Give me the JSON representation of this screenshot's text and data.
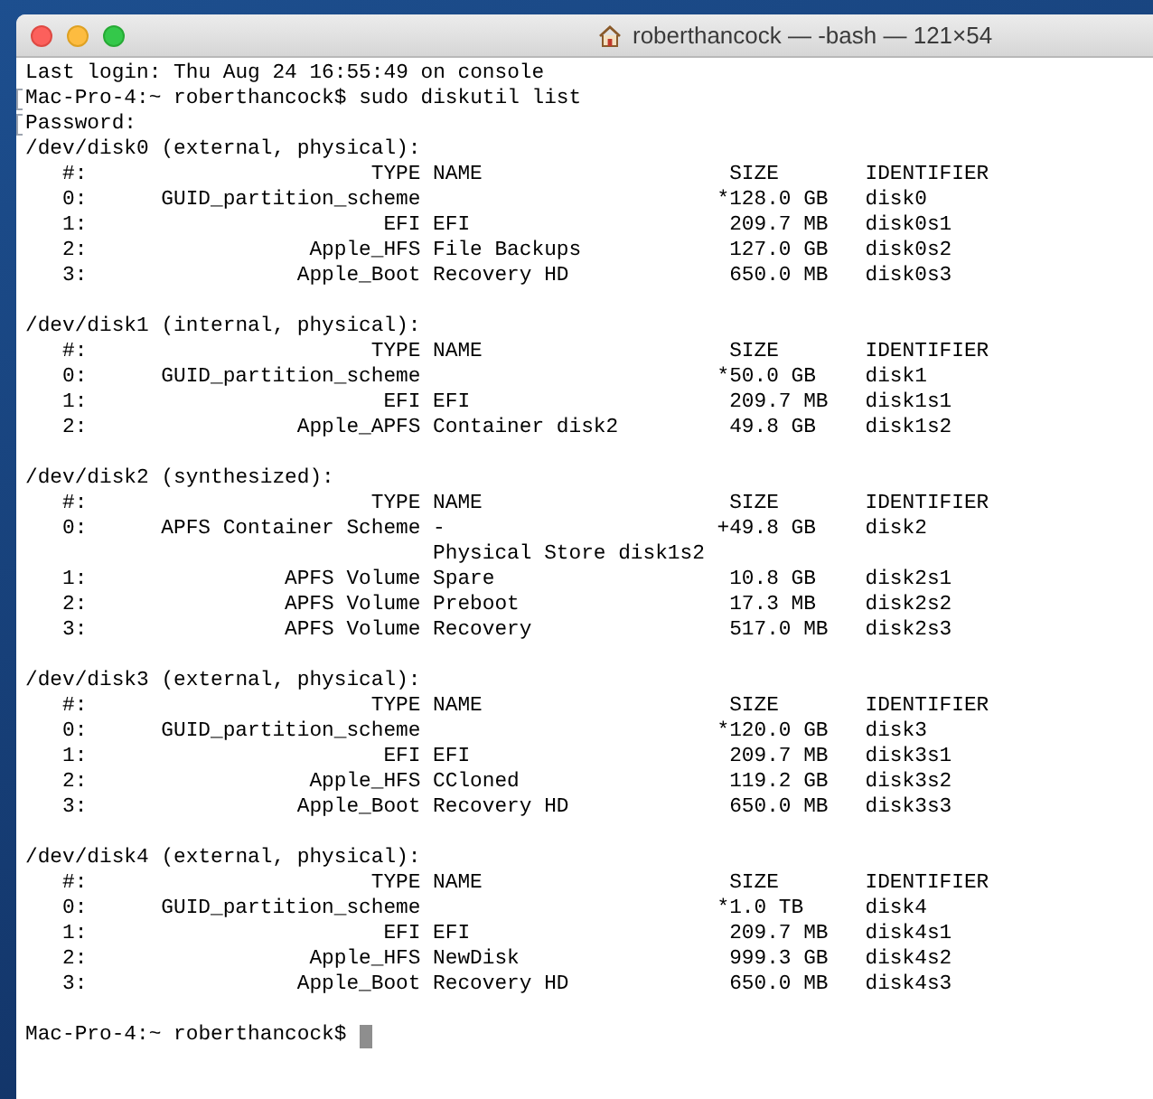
{
  "window": {
    "title": "roberthancock — -bash — 121×54"
  },
  "terminal": {
    "login": "Last login: Thu Aug 24 16:55:49 on console",
    "command": {
      "prompt": "Mac-Pro-4:~ roberthancock$",
      "text": "sudo diskutil list",
      "marked": true
    },
    "password": {
      "text": "Password:",
      "marked": true
    },
    "disks": [
      {
        "header": "/dev/disk0 (external, physical):",
        "columns": {
          "number": "#:",
          "type": "TYPE",
          "name": "NAME",
          "size": "SIZE",
          "identifier": "IDENTIFIER"
        },
        "rows": [
          {
            "number": "0:",
            "type": "GUID_partition_scheme",
            "flag": "*",
            "size": "128.0 GB",
            "identifier": "disk0"
          },
          {
            "number": "1:",
            "type": "EFI",
            "name": "EFI",
            "size": "209.7 MB",
            "identifier": "disk0s1"
          },
          {
            "number": "2:",
            "type": "Apple_HFS",
            "name": "File Backups",
            "size": "127.0 GB",
            "identifier": "disk0s2"
          },
          {
            "number": "3:",
            "type": "Apple_Boot",
            "name": "Recovery HD",
            "size": "650.0 MB",
            "identifier": "disk0s3"
          }
        ]
      },
      {
        "header": "/dev/disk1 (internal, physical):",
        "columns": {
          "number": "#:",
          "type": "TYPE",
          "name": "NAME",
          "size": "SIZE",
          "identifier": "IDENTIFIER"
        },
        "rows": [
          {
            "number": "0:",
            "type": "GUID_partition_scheme",
            "flag": "*",
            "size": "50.0 GB",
            "identifier": "disk1"
          },
          {
            "number": "1:",
            "type": "EFI",
            "name": "EFI",
            "size": "209.7 MB",
            "identifier": "disk1s1"
          },
          {
            "number": "2:",
            "type": "Apple_APFS",
            "name": "Container disk2",
            "size": "49.8 GB",
            "identifier": "disk1s2"
          }
        ]
      },
      {
        "header": "/dev/disk2 (synthesized):",
        "columns": {
          "number": "#:",
          "type": "TYPE",
          "name": "NAME",
          "size": "SIZE",
          "identifier": "IDENTIFIER"
        },
        "rows": [
          {
            "number": "0:",
            "type": "APFS Container Scheme",
            "name": "-",
            "flag": "+",
            "size": "49.8 GB",
            "identifier": "disk2"
          },
          {
            "name": "Physical Store disk1s2"
          },
          {
            "number": "1:",
            "type": "APFS Volume",
            "name": "Spare",
            "size": "10.8 GB",
            "identifier": "disk2s1"
          },
          {
            "number": "2:",
            "type": "APFS Volume",
            "name": "Preboot",
            "size": "17.3 MB",
            "identifier": "disk2s2"
          },
          {
            "number": "3:",
            "type": "APFS Volume",
            "name": "Recovery",
            "size": "517.0 MB",
            "identifier": "disk2s3"
          }
        ]
      },
      {
        "header": "/dev/disk3 (external, physical):",
        "columns": {
          "number": "#:",
          "type": "TYPE",
          "name": "NAME",
          "size": "SIZE",
          "identifier": "IDENTIFIER"
        },
        "rows": [
          {
            "number": "0:",
            "type": "GUID_partition_scheme",
            "flag": "*",
            "size": "120.0 GB",
            "identifier": "disk3"
          },
          {
            "number": "1:",
            "type": "EFI",
            "name": "EFI",
            "size": "209.7 MB",
            "identifier": "disk3s1"
          },
          {
            "number": "2:",
            "type": "Apple_HFS",
            "name": "CCloned",
            "size": "119.2 GB",
            "identifier": "disk3s2"
          },
          {
            "number": "3:",
            "type": "Apple_Boot",
            "name": "Recovery HD",
            "size": "650.0 MB",
            "identifier": "disk3s3"
          }
        ]
      },
      {
        "header": "/dev/disk4 (external, physical):",
        "columns": {
          "number": "#:",
          "type": "TYPE",
          "name": "NAME",
          "size": "SIZE",
          "identifier": "IDENTIFIER"
        },
        "rows": [
          {
            "number": "0:",
            "type": "GUID_partition_scheme",
            "flag": "*",
            "size": "1.0 TB",
            "identifier": "disk4"
          },
          {
            "number": "1:",
            "type": "EFI",
            "name": "EFI",
            "size": "209.7 MB",
            "identifier": "disk4s1"
          },
          {
            "number": "2:",
            "type": "Apple_HFS",
            "name": "NewDisk",
            "size": "999.3 GB",
            "identifier": "disk4s2"
          },
          {
            "number": "3:",
            "type": "Apple_Boot",
            "name": "Recovery HD",
            "size": "650.0 MB",
            "identifier": "disk4s3"
          }
        ]
      }
    ],
    "final_prompt": "Mac-Pro-4:~ roberthancock$"
  }
}
